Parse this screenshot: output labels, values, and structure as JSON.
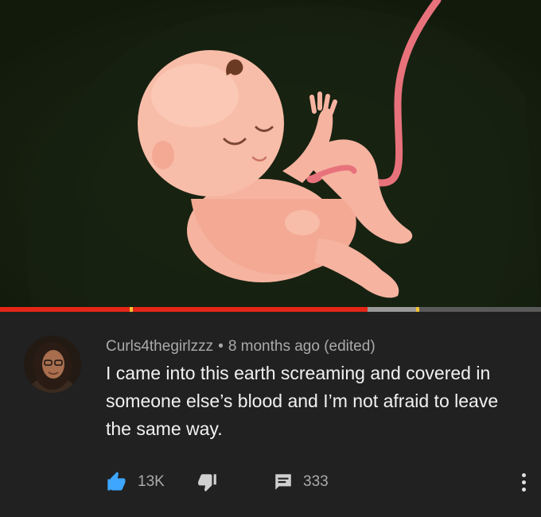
{
  "video": {
    "background_color": "#16200f",
    "illustration": "fetus-with-umbilical-cord",
    "progress": {
      "played_fraction": 0.68,
      "buffered_fraction": 0.77,
      "marker_color": "#f1c232",
      "played_color": "#e52617"
    }
  },
  "comment": {
    "author": "Curls4thegirlzzz",
    "separator": "•",
    "time": "8 months ago (edited)",
    "text": "I came into this earth screaming and covered in someone else’s blood and I’m not afraid to leave the same way.",
    "likes": "13K",
    "replies": "333",
    "like_color": "#3ea6ff"
  },
  "icons": {
    "like": "thumbs-up-icon",
    "dislike": "thumbs-down-icon",
    "reply": "comment-icon",
    "more": "more-vert-icon"
  }
}
